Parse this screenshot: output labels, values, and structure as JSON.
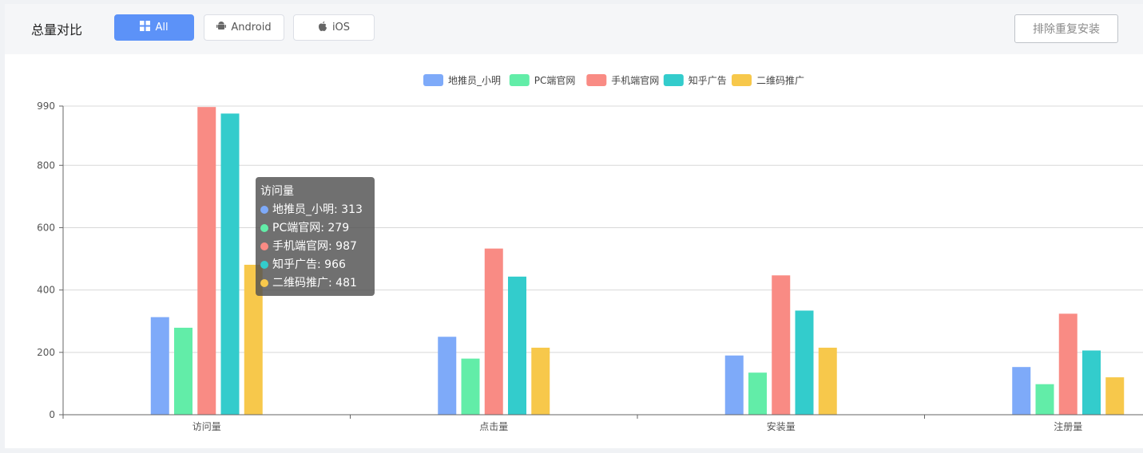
{
  "header": {
    "title": "总量对比",
    "tabs": [
      {
        "label": "All",
        "icon": "grid-icon",
        "active": true
      },
      {
        "label": "Android",
        "icon": "android-icon",
        "active": false
      },
      {
        "label": "iOS",
        "icon": "apple-icon",
        "active": false
      }
    ],
    "exclude_button": "排除重复安装"
  },
  "colors": {
    "accent": "#5c92f8",
    "series": [
      "#7eaaf9",
      "#62eda8",
      "#f98b84",
      "#33cccc",
      "#f7c84b"
    ]
  },
  "chart_data": {
    "type": "bar",
    "categories": [
      "访问量",
      "点击量",
      "安装量",
      "注册量"
    ],
    "series": [
      {
        "name": "地推员_小明",
        "values": [
          313,
          250,
          190,
          153
        ]
      },
      {
        "name": "PC端官网",
        "values": [
          279,
          180,
          135,
          98
        ]
      },
      {
        "name": "手机端官网",
        "values": [
          987,
          533,
          447,
          324
        ]
      },
      {
        "name": "知乎广告",
        "values": [
          966,
          443,
          334,
          206
        ]
      },
      {
        "name": "二维码推广",
        "values": [
          481,
          215,
          215,
          120
        ]
      }
    ],
    "yticks": [
      0,
      200,
      400,
      600,
      800,
      990
    ],
    "ylim": [
      0,
      990
    ],
    "grid": true,
    "legend_position": "top-center"
  },
  "tooltip": {
    "title": "访问量",
    "rows": [
      "地推员_小明: 313",
      "PC端官网: 279",
      "手机端官网: 987",
      "知乎广告: 966",
      "二维码推广: 481"
    ]
  }
}
